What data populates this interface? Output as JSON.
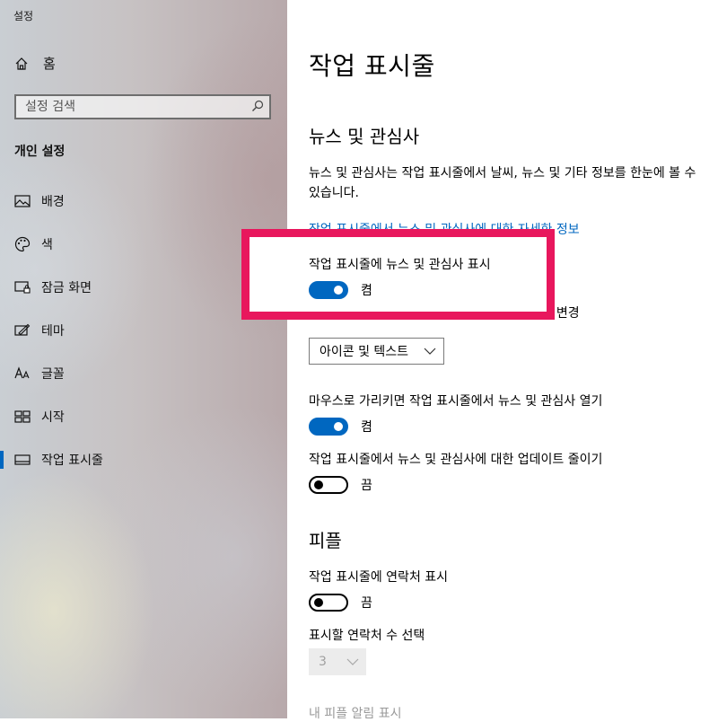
{
  "window": {
    "title": "설정"
  },
  "sidebar": {
    "home_label": "홈",
    "search_placeholder": "설정 검색",
    "section_label": "개인 설정",
    "items": [
      {
        "label": "배경",
        "icon": "image-icon"
      },
      {
        "label": "색",
        "icon": "palette-icon"
      },
      {
        "label": "잠금 화면",
        "icon": "lock-screen-icon"
      },
      {
        "label": "테마",
        "icon": "theme-icon"
      },
      {
        "label": "글꼴",
        "icon": "font-icon"
      },
      {
        "label": "시작",
        "icon": "start-icon"
      },
      {
        "label": "작업 표시줄",
        "icon": "taskbar-icon",
        "selected": true
      }
    ]
  },
  "main": {
    "title": "작업 표시줄",
    "news": {
      "heading": "뉴스 및 관심사",
      "description": "뉴스 및 관심사는 작업 표시줄에서 날씨, 뉴스 및 기타 정보를 한눈에 볼 수 있습니다.",
      "link_prefix": "작업 표시줄에서 뉴스 및 관심사에 대한 ",
      "link_suffix": "자세한 정보",
      "show_label": "작업 표시줄에 뉴스 및 관심사 표시",
      "show_state": "켬",
      "display_label": "작업 표시줄에 뉴스 및 관심사가 표시되는 방식 변경",
      "display_value": "아이콘 및 텍스트",
      "hover_label": "마우스로 가리키면 작업 표시줄에서 뉴스 및 관심사 열기",
      "hover_state": "켬",
      "reduce_label": "작업 표시줄에서 뉴스 및 관심사에 대한 업데이트 줄이기",
      "reduce_state": "끔"
    },
    "people": {
      "heading": "피플",
      "contacts_label": "작업 표시줄에 연락처 표시",
      "contacts_state": "끔",
      "count_label": "표시할 연락처 수 선택",
      "count_value": "3",
      "notify_label": "내 피플 알림 표시"
    }
  },
  "colors": {
    "accent": "#0067c0",
    "highlight": "#e8175d"
  }
}
